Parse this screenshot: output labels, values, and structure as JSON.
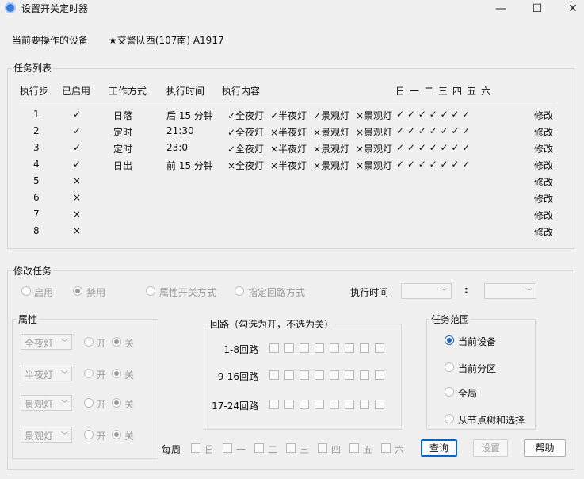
{
  "window": {
    "title": "设置开关定时器",
    "minimize": "—",
    "maximize": "☐",
    "close": "✕"
  },
  "device": {
    "label": "当前要操作的设备",
    "name": "★交警队西(107南) A1917"
  },
  "task_list": {
    "title": "任务列表",
    "headers": {
      "step": "执行步",
      "enabled": "已启用",
      "mode": "工作方式",
      "time": "执行时间",
      "content": "执行内容",
      "days": [
        "日",
        "一",
        "二",
        "三",
        "四",
        "五",
        "六"
      ]
    },
    "rows": [
      {
        "step": "1",
        "enabled": "✓",
        "mode": "日落",
        "time": "后 15 分钟",
        "c1": "✓全夜灯",
        "c2": "✓半夜灯",
        "c3": "✓景观灯",
        "c4": "×景观灯",
        "days": "✓ ✓ ✓ ✓ ✓ ✓ ✓",
        "edit": "修改"
      },
      {
        "step": "2",
        "enabled": "✓",
        "mode": "定时",
        "time": "21:30",
        "c1": "✓全夜灯",
        "c2": "×半夜灯",
        "c3": "×景观灯",
        "c4": "×景观灯",
        "days": "✓ ✓ ✓ ✓ ✓ ✓ ✓",
        "edit": "修改"
      },
      {
        "step": "3",
        "enabled": "✓",
        "mode": "定时",
        "time": "23:0",
        "c1": "✓全夜灯",
        "c2": "×半夜灯",
        "c3": "×景观灯",
        "c4": "×景观灯",
        "days": "✓ ✓ ✓ ✓ ✓ ✓ ✓",
        "edit": "修改"
      },
      {
        "step": "4",
        "enabled": "✓",
        "mode": "日出",
        "time": "前 15 分钟",
        "c1": "×全夜灯",
        "c2": "×半夜灯",
        "c3": "×景观灯",
        "c4": "×景观灯",
        "days": "✓ ✓ ✓ ✓ ✓ ✓ ✓",
        "edit": "修改"
      },
      {
        "step": "5",
        "enabled": "×",
        "mode": "",
        "time": "",
        "c1": "",
        "c2": "",
        "c3": "",
        "c4": "",
        "days": "",
        "edit": "修改"
      },
      {
        "step": "6",
        "enabled": "×",
        "mode": "",
        "time": "",
        "c1": "",
        "c2": "",
        "c3": "",
        "c4": "",
        "days": "",
        "edit": "修改"
      },
      {
        "step": "7",
        "enabled": "×",
        "mode": "",
        "time": "",
        "c1": "",
        "c2": "",
        "c3": "",
        "c4": "",
        "days": "",
        "edit": "修改"
      },
      {
        "step": "8",
        "enabled": "×",
        "mode": "",
        "time": "",
        "c1": "",
        "c2": "",
        "c3": "",
        "c4": "",
        "days": "",
        "edit": "修改"
      }
    ]
  },
  "edit_task": {
    "title": "修改任务",
    "enable": "启用",
    "disable": "禁用",
    "attr_mode": "属性开关方式",
    "circuit_mode": "指定回路方式",
    "exec_time_label": "执行时间",
    "time_sep": ":",
    "hour_value": "",
    "minute_value": ""
  },
  "attributes": {
    "title": "属性",
    "on": "开",
    "off": "关",
    "items": [
      "全夜灯",
      "半夜灯",
      "景观灯",
      "景观灯"
    ]
  },
  "circuits": {
    "title": "回路（勾选为开，不选为关）",
    "rows": [
      "1-8回路",
      "9-16回路",
      "17-24回路"
    ]
  },
  "scope": {
    "title": "任务范围",
    "options": [
      "当前设备",
      "当前分区",
      "全局",
      "从节点树和选择"
    ],
    "selected": "当前设备"
  },
  "weekly": {
    "label": "每周",
    "days": [
      "日",
      "一",
      "二",
      "三",
      "四",
      "五",
      "六"
    ]
  },
  "buttons": {
    "query": "查询",
    "set": "设置",
    "help": "帮助"
  },
  "colors": {
    "accent": "#1f5fb8",
    "window_bg": "#f0f0f0"
  }
}
